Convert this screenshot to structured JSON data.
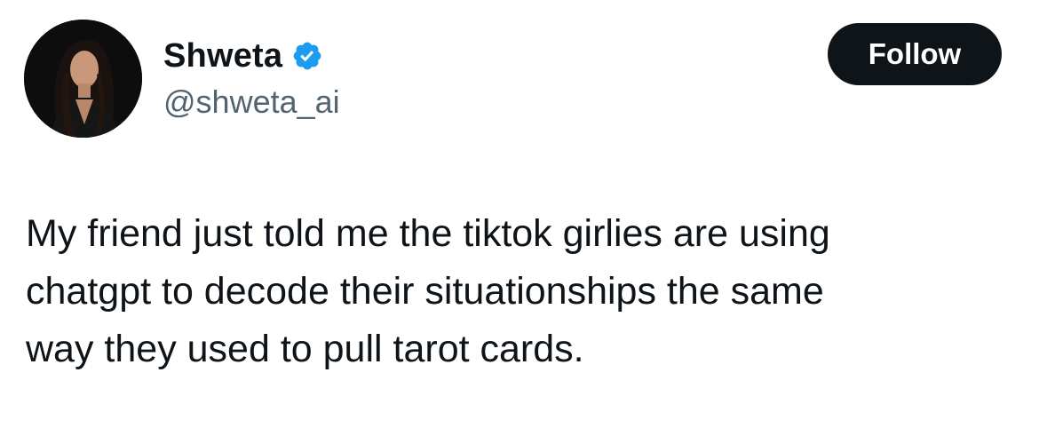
{
  "author": {
    "display_name": "Shweta",
    "handle": "@shweta_ai",
    "verified": true
  },
  "follow_button": {
    "label": "Follow"
  },
  "tweet": {
    "lines": [
      "My friend just told me the tiktok girlies are using",
      "chatgpt to decode their situationships the same",
      "way they used to pull tarot cards."
    ]
  },
  "colors": {
    "text": "#0f1419",
    "secondary": "#536471",
    "verified_badge": "#1d9bf0",
    "button_bg": "#0f1419",
    "button_text": "#ffffff"
  },
  "icons": {
    "verified": "verified-badge-icon"
  }
}
